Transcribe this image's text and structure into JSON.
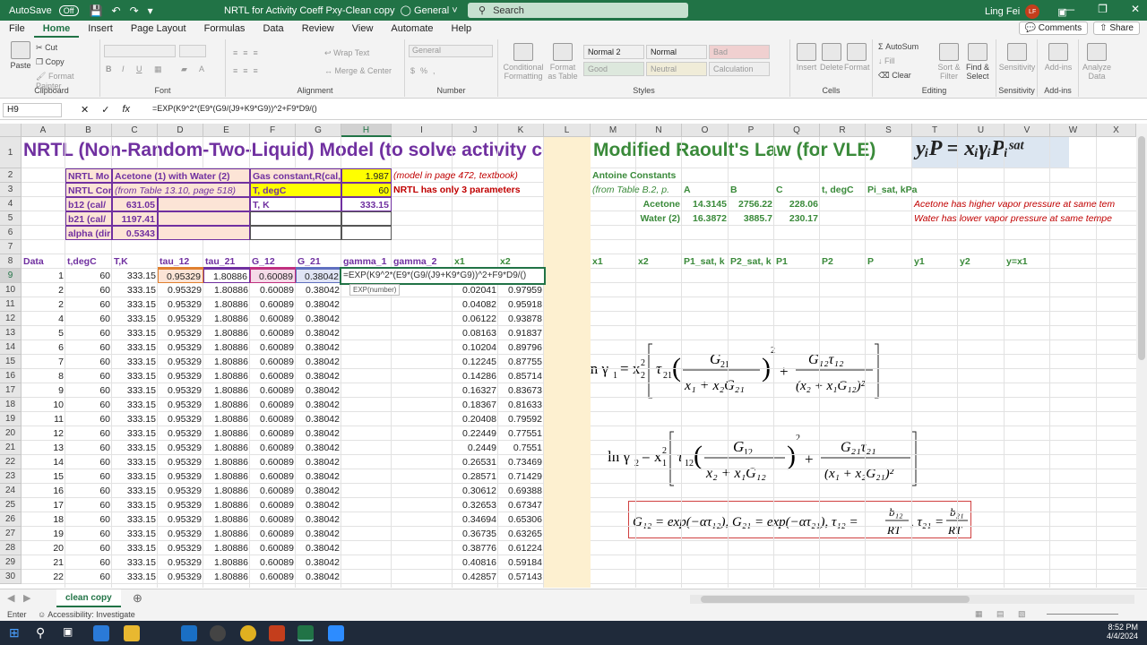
{
  "titlebar": {
    "autosave_label": "AutoSave",
    "autosave_state": "Off",
    "file_name": "NRTL for Activity Coeff Pxy-Clean copy",
    "sensitivity": "General",
    "search_placeholder": "Search",
    "user_name": "Ling Fei",
    "user_initials": "LF"
  },
  "menu": {
    "tabs": [
      "File",
      "Home",
      "Insert",
      "Page Layout",
      "Formulas",
      "Data",
      "Review",
      "View",
      "Automate",
      "Help"
    ],
    "comments": "Comments",
    "share": "Share"
  },
  "ribbon": {
    "clipboard": {
      "label": "Clipboard",
      "paste": "Paste",
      "cut": "Cut",
      "copy": "Copy",
      "format_painter": "Format Painter"
    },
    "font": {
      "label": "Font"
    },
    "alignment": {
      "label": "Alignment",
      "wrap": "Wrap Text",
      "merge": "Merge & Center"
    },
    "number": {
      "label": "Number",
      "format": "General"
    },
    "styles": {
      "label": "Styles",
      "conditional": "Conditional Formatting",
      "format_table": "Format as Table",
      "normal2": "Normal 2",
      "normal": "Normal",
      "bad": "Bad",
      "good": "Good",
      "neutral": "Neutral",
      "calculation": "Calculation"
    },
    "cells": {
      "label": "Cells",
      "insert": "Insert",
      "delete": "Delete",
      "format": "Format"
    },
    "editing": {
      "label": "Editing",
      "autosum": "AutoSum",
      "fill": "Fill",
      "clear": "Clear",
      "sort": "Sort & Filter",
      "find": "Find & Select"
    },
    "sensitivity": {
      "label": "Sensitivity",
      "btn": "Sensitivity"
    },
    "addins": {
      "label": "Add-ins",
      "btn": "Add-ins"
    },
    "analyze": {
      "label": "",
      "btn": "Analyze Data"
    }
  },
  "formula_bar": {
    "name_box": "H9",
    "formula": "=EXP(K9^2*(E9*(G9/(J9+K9*G9))^2+F9*D9/()"
  },
  "columns": [
    "A",
    "B",
    "C",
    "D",
    "E",
    "F",
    "G",
    "H",
    "I",
    "J",
    "K",
    "L",
    "M",
    "N",
    "O",
    "P",
    "Q",
    "R",
    "S",
    "T",
    "U",
    "V",
    "W",
    "X"
  ],
  "sheet": {
    "title_nrtl": "NRTL (Non-Random-Two-Liquid) Model (to solve activity coe",
    "title_raoult": "Modified Raoult's Law (for VLE)",
    "eq_raoult": "yᵢP = xᵢγᵢPᵢˢᵃᵗ",
    "b2": "NRTL Mo",
    "c2": "Acetone (1) with Water (2)",
    "f2": "Gas constant,R(cal,",
    "h2": "1.987",
    "i2": "(model in page 472, textbook)",
    "b3": "NRTL Con",
    "c3": "(from Table 13.10, page 518)",
    "f3": "T, degC",
    "h3": "60",
    "i3": "NRTL has only 3 parameters",
    "b4": "b12 (cal/",
    "c4": "631.05",
    "f4": "T, K",
    "h4": "333.15",
    "b5": "b21 (cal/",
    "c5": "1197.41",
    "b6": "alpha (dir",
    "c6": "0.5343",
    "m2": "Antoine Constants",
    "m3": "(from Table B.2, p.",
    "o3": "A",
    "p3": "B",
    "q3": "C",
    "r3": "t, degC",
    "s3": "Pi_sat, kPa",
    "n4": "Acetone",
    "o4": "14.3145",
    "p4": "2756.22",
    "q4": "228.06",
    "n5": "Water (2)",
    "o5": "16.3872",
    "p5": "3885.7",
    "q5": "230.17",
    "t4": "Acetone has higher vapor pressure at same tem",
    "t5": "Water has lower vapor pressure at same tempe",
    "headers_left": [
      "Data",
      "t,degC",
      "T,K",
      "tau_12",
      "tau_21",
      "G_12",
      "G_21",
      "gamma_1",
      "gamma_2",
      "x1",
      "x2"
    ],
    "headers_right": [
      "x1",
      "x2",
      "P1_sat, k",
      "P2_sat, k",
      "P1",
      "P2",
      "P",
      "y1",
      "y2",
      "y=x1"
    ],
    "edit_formula": "=EXP(K9^2*(E9*(G9/(J9+K9*G9))^2+F9*D9/()",
    "tooltip": "EXP(number)",
    "tau12": "0.95329",
    "tau21": "1.80886",
    "g12": "0.60089",
    "g21": "0.38042",
    "tdeg": "60",
    "tk": "333.15",
    "data_rows": [
      {
        "n": "1",
        "x1": "",
        "x2": ""
      },
      {
        "n": "2",
        "x1": "0.02041",
        "x2": "0.97959"
      },
      {
        "n": "2",
        "x1": "0.04082",
        "x2": "0.95918"
      },
      {
        "n": "4",
        "x1": "0.06122",
        "x2": "0.93878"
      },
      {
        "n": "5",
        "x1": "0.08163",
        "x2": "0.91837"
      },
      {
        "n": "6",
        "x1": "0.10204",
        "x2": "0.89796"
      },
      {
        "n": "7",
        "x1": "0.12245",
        "x2": "0.87755"
      },
      {
        "n": "8",
        "x1": "0.14286",
        "x2": "0.85714"
      },
      {
        "n": "9",
        "x1": "0.16327",
        "x2": "0.83673"
      },
      {
        "n": "10",
        "x1": "0.18367",
        "x2": "0.81633"
      },
      {
        "n": "11",
        "x1": "0.20408",
        "x2": "0.79592"
      },
      {
        "n": "12",
        "x1": "0.22449",
        "x2": "0.77551"
      },
      {
        "n": "13",
        "x1": "0.2449",
        "x2": "0.7551"
      },
      {
        "n": "14",
        "x1": "0.26531",
        "x2": "0.73469"
      },
      {
        "n": "15",
        "x1": "0.28571",
        "x2": "0.71429"
      },
      {
        "n": "16",
        "x1": "0.30612",
        "x2": "0.69388"
      },
      {
        "n": "17",
        "x1": "0.32653",
        "x2": "0.67347"
      },
      {
        "n": "18",
        "x1": "0.34694",
        "x2": "0.65306"
      },
      {
        "n": "19",
        "x1": "0.36735",
        "x2": "0.63265"
      },
      {
        "n": "20",
        "x1": "0.38776",
        "x2": "0.61224"
      },
      {
        "n": "21",
        "x1": "0.40816",
        "x2": "0.59184"
      },
      {
        "n": "22",
        "x1": "0.42857",
        "x2": "0.57143"
      }
    ],
    "row_numbers": [
      "1",
      "2",
      "3",
      "4",
      "5",
      "6",
      "7",
      "8",
      "9",
      "10",
      "11",
      "12",
      "13",
      "14",
      "15",
      "16",
      "17",
      "18",
      "19",
      "20",
      "21",
      "22",
      "23",
      "24",
      "25",
      "26",
      "27",
      "28",
      "29",
      "30"
    ]
  },
  "sheetbar": {
    "tab": "clean copy"
  },
  "status": {
    "mode": "Enter",
    "accessibility": "Accessibility: Investigate"
  },
  "clock": {
    "time": "8:52 PM",
    "date": "4/4/2024"
  },
  "colors": {
    "excel_green": "#217346",
    "purple": "#7030a0",
    "raoult_green": "#3a8a3a",
    "pink": "#fce4d6",
    "yellow": "#ffff00",
    "red": "#c00000"
  }
}
